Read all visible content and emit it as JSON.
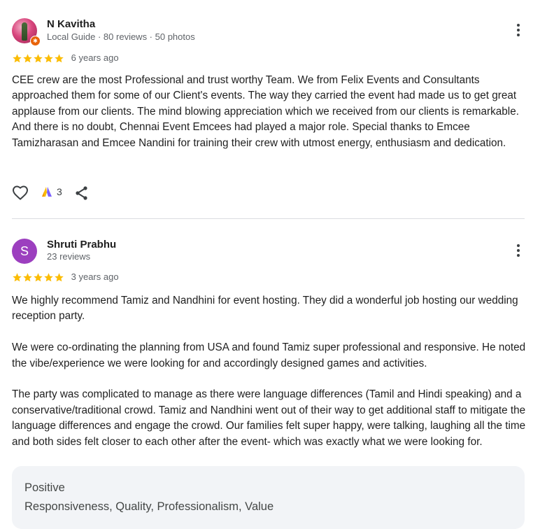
{
  "reviews": [
    {
      "author": "N Kavitha",
      "meta": "Local Guide · 80 reviews · 50 photos",
      "rating": 5,
      "date": "6 years ago",
      "text": "CEE crew are the most Professional and trust worthy Team. We from Felix Events and Consultants approached them for some of our Client's events. The way they carried the event had made us to get great applause from our clients. The mind blowing appreciation which we received from our clients is remarkable. And there is no doubt, Chennai Event Emcees had played a major role. Special thanks to Emcee Tamizharasan and Emcee Nandini for training their crew with utmost energy, enthusiasm and dedication.",
      "reaction_count": "3",
      "icons": [
        "like-icon",
        "clap-reaction-icon",
        "share-icon",
        "more-options-icon",
        "local-guide-badge-icon"
      ]
    },
    {
      "author": "Shruti Prabhu",
      "avatar_letter": "S",
      "avatar_color": "#9c3fbf",
      "meta": "23 reviews",
      "rating": 5,
      "date": "3 years ago",
      "text": "We highly recommend Tamiz and Nandhini for event hosting. They did a wonderful job hosting our wedding reception party.\n\nWe were co-ordinating the planning from USA and found Tamiz super professional and responsive. He noted the vibe/experience we were looking for and accordingly designed games and activities.\n\nThe party was complicated to manage as there were language differences (Tamil and Hindi speaking) and a conservative/traditional crowd. Tamiz and Nandhini went out of their way to get additional staff to mitigate the language differences and engage the crowd. Our families felt super happy, were talking, laughing all the time and both sides felt closer to each other after the event- which was exactly what we were looking for.",
      "highlights": {
        "label": "Positive",
        "value": "Responsiveness, Quality, Professionalism, Value"
      }
    }
  ],
  "colors": {
    "star": "#fbbc04",
    "text": "#1f1f1f",
    "muted": "#5f6368",
    "divider": "#dadce0"
  }
}
